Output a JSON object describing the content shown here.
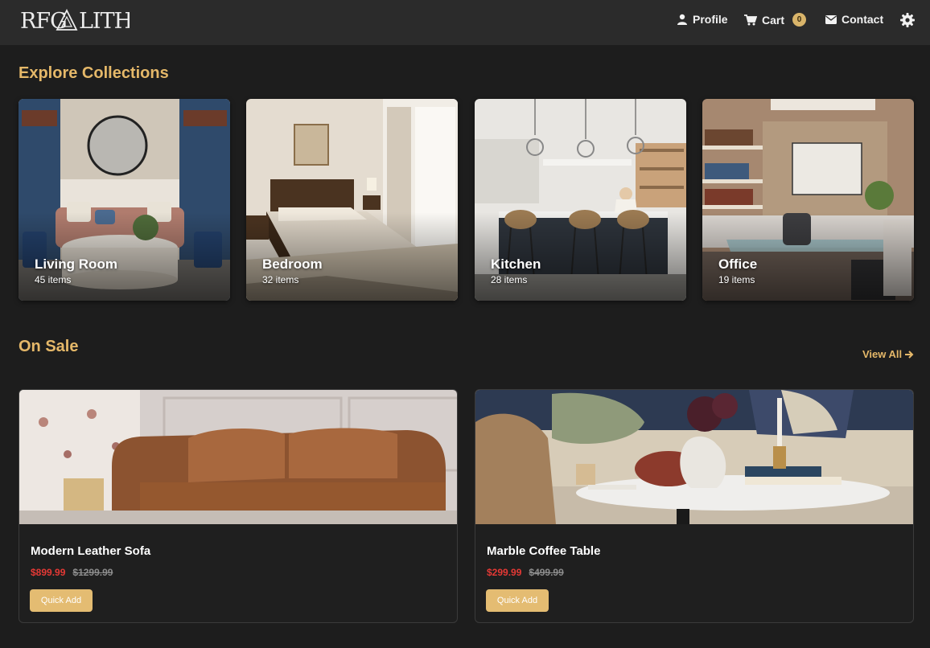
{
  "header": {
    "logo_text": "REGALITH",
    "nav": [
      {
        "label": "Profile",
        "icon": "user-icon"
      },
      {
        "label": "Cart",
        "icon": "cart-icon",
        "badge": "0"
      },
      {
        "label": "Contact",
        "icon": "envelope-icon"
      }
    ],
    "settings_icon": "gear-icon"
  },
  "collections": {
    "title": "Explore Collections",
    "items": [
      {
        "name": "Living Room",
        "count": "45 items"
      },
      {
        "name": "Bedroom",
        "count": "32 items"
      },
      {
        "name": "Kitchen",
        "count": "28 items"
      },
      {
        "name": "Office",
        "count": "19 items"
      }
    ]
  },
  "sale": {
    "title": "On Sale",
    "view_all": "View All",
    "products": [
      {
        "name": "Modern Leather Sofa",
        "price": "$899.99",
        "old_price": "$1299.99",
        "button": "Quick Add"
      },
      {
        "name": "Marble Coffee Table",
        "price": "$299.99",
        "old_price": "$499.99",
        "button": "Quick Add"
      }
    ]
  },
  "colors": {
    "background": "#1d1d1d",
    "header": "#2b2b2b",
    "accent": "#e5b869",
    "sale_price": "#e53935",
    "old_price": "#8c8c8c"
  }
}
